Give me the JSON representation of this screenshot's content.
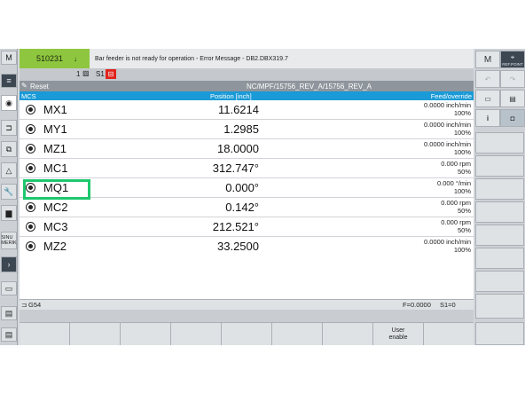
{
  "header": {
    "alarm_code": "510231",
    "alarm_arrow": "↓",
    "alarm_message": "Bar feeder is not ready for operation - Error Message -  DB2.DBX319.7"
  },
  "status": {
    "channel_number": "1",
    "spindle_label": "S1"
  },
  "program": {
    "reset_label": "Reset",
    "path": "NC/MPF/15756_REV_A/15756_REV_A"
  },
  "columns": {
    "coord_system": "MCS",
    "position": "Position [inch]",
    "feed": "Feed/override"
  },
  "axes": [
    {
      "name": "MX1",
      "position": "11.6214",
      "feed": "0.0000 inch/min",
      "override": "100%"
    },
    {
      "name": "MY1",
      "position": "1.2985",
      "feed": "0.0000 inch/min",
      "override": "100%"
    },
    {
      "name": "MZ1",
      "position": "18.0000",
      "feed": "0.0000 inch/min",
      "override": "100%"
    },
    {
      "name": "MC1",
      "position": "312.747°",
      "feed": "0.000 rpm",
      "override": "50%"
    },
    {
      "name": "MQ1",
      "position": "0.000°",
      "feed": "0.000 °/min",
      "override": "100%"
    },
    {
      "name": "MC2",
      "position": "0.142°",
      "feed": "0.000 rpm",
      "override": "50%"
    },
    {
      "name": "MC3",
      "position": "212.521°",
      "feed": "0.000 rpm",
      "override": "50%"
    },
    {
      "name": "MZ2",
      "position": "33.2500",
      "feed": "0.0000 inch/min",
      "override": "100%"
    }
  ],
  "bottom": {
    "work_offset": "G54",
    "feed_value": "F=0.0000",
    "spindle_value": "S1=0"
  },
  "softkeys": [
    "",
    "",
    "",
    "",
    "",
    "",
    "",
    "User\nenable",
    ""
  ],
  "right_panel": {
    "ref_point_label": "REF.POINT",
    "info_label": "i"
  },
  "left_panel": {
    "sinumerik_label": "SINU\nMERIK"
  },
  "colors": {
    "alarm_green": "#8ec63f",
    "header_blue": "#1a9ad6",
    "highlight_green": "#1ec86e",
    "spindle_red": "#e0231c"
  }
}
